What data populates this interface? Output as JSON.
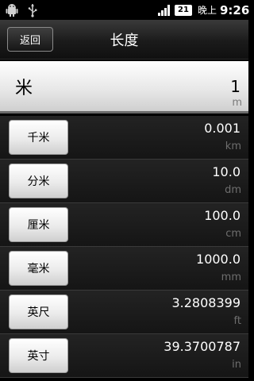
{
  "status_bar": {
    "battery": "21",
    "ampm": "晚上",
    "time": "9:26",
    "icons": [
      "android-icon",
      "usb-icon",
      "signal-icon",
      "battery-icon"
    ]
  },
  "header": {
    "back_label": "返回",
    "title": "长度"
  },
  "main_unit": {
    "name": "米",
    "value": "1",
    "abbr": "m"
  },
  "rows": [
    {
      "label": "千米",
      "value": "0.001",
      "abbr": "km"
    },
    {
      "label": "分米",
      "value": "10.0",
      "abbr": "dm"
    },
    {
      "label": "厘米",
      "value": "100.0",
      "abbr": "cm"
    },
    {
      "label": "毫米",
      "value": "1000.0",
      "abbr": "mm"
    },
    {
      "label": "英尺",
      "value": "3.2808399",
      "abbr": "ft"
    },
    {
      "label": "英寸",
      "value": "39.3700787",
      "abbr": "in"
    }
  ]
}
